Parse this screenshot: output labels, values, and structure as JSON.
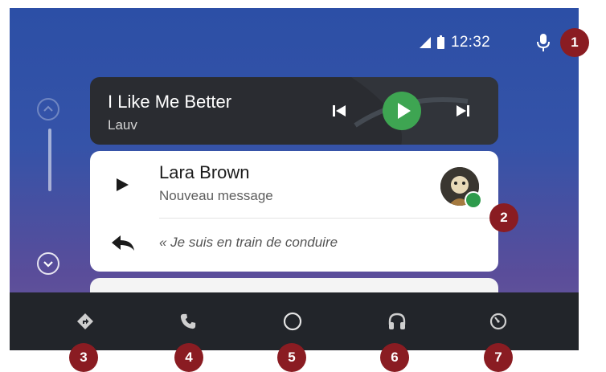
{
  "status_bar": {
    "time": "12:32"
  },
  "now_playing": {
    "title": "I Like Me Better",
    "artist": "Lauv"
  },
  "message": {
    "sender": "Lara Brown",
    "subtitle": "Nouveau message",
    "reply": "« Je suis en train de conduire"
  },
  "nav": {
    "items": [
      "navigation-icon",
      "phone-icon",
      "home-icon",
      "headphones-icon",
      "recents-icon"
    ]
  },
  "callouts": [
    "1",
    "2",
    "3",
    "4",
    "5",
    "6",
    "7"
  ],
  "colors": {
    "accent_green": "#3ea552",
    "callout": "#8a1c22",
    "nav_bar": "#22252a",
    "screen_top": "#2c4fa6",
    "screen_bottom": "#6c5b9a"
  }
}
